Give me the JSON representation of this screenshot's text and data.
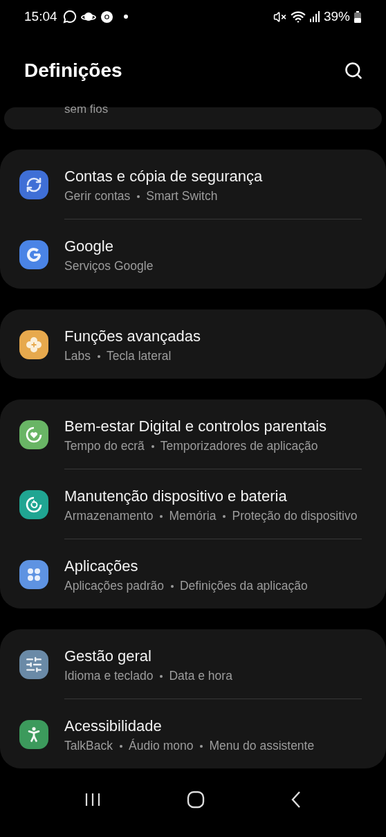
{
  "status_bar": {
    "time": "15:04",
    "battery": "39%"
  },
  "header": {
    "title": "Definições"
  },
  "partial_card": {
    "subtitle": "sem fios"
  },
  "groups": [
    {
      "items": [
        {
          "kind": "sync",
          "color": "#3f6fd6",
          "title": "Contas e cópia de segurança",
          "subtitle": [
            "Gerir contas",
            "Smart Switch"
          ]
        },
        {
          "kind": "google",
          "color": "#4a84e6",
          "title": "Google",
          "subtitle": [
            "Serviços Google"
          ]
        }
      ]
    },
    {
      "items": [
        {
          "kind": "flower",
          "color": "#e7a94d",
          "title": "Funções avançadas",
          "subtitle": [
            "Labs",
            "Tecla lateral"
          ]
        }
      ]
    },
    {
      "items": [
        {
          "kind": "heart",
          "color": "#69b565",
          "title": "Bem-estar Digital e controlos parentais",
          "subtitle": [
            "Tempo do ecrã",
            "Temporizadores de aplicação"
          ]
        },
        {
          "kind": "care",
          "color": "#20a592",
          "title": "Manutenção dispositivo e bateria",
          "subtitle": [
            "Armazenamento",
            "Memória",
            "Proteção do dispositivo"
          ]
        },
        {
          "kind": "apps",
          "color": "#5e93e2",
          "title": "Aplicações",
          "subtitle": [
            "Aplicações padrão",
            "Definições da aplicação"
          ]
        }
      ]
    },
    {
      "items": [
        {
          "kind": "sliders",
          "color": "#6a8aa7",
          "title": "Gestão geral",
          "subtitle": [
            "Idioma e teclado",
            "Data e hora"
          ]
        },
        {
          "kind": "person",
          "color": "#3c9a5c",
          "title": "Acessibilidade",
          "subtitle": [
            "TalkBack",
            "Áudio mono",
            "Menu do assistente"
          ]
        }
      ]
    }
  ]
}
